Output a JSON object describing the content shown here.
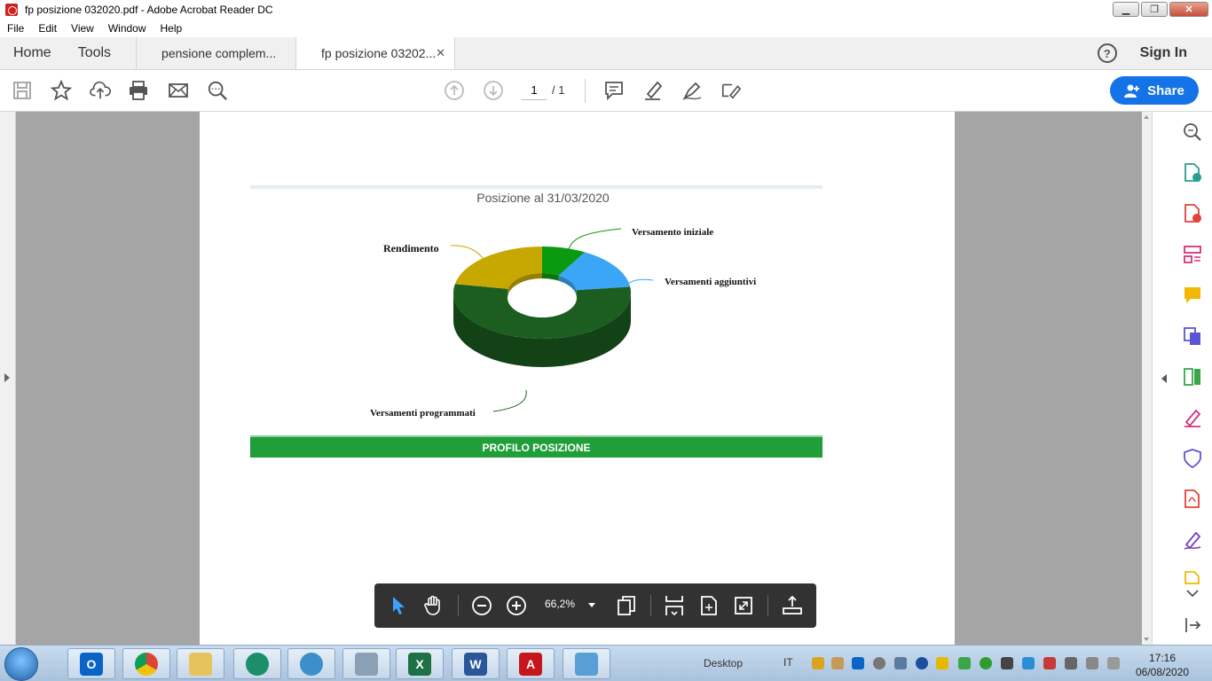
{
  "window": {
    "title": "fp posizione 032020.pdf - Adobe Acrobat Reader DC",
    "buttons": {
      "minimize": "▁",
      "maximize": "❐",
      "close": "✕"
    }
  },
  "menu": [
    "File",
    "Edit",
    "View",
    "Window",
    "Help"
  ],
  "tabs": {
    "home": "Home",
    "tools": "Tools",
    "documents": [
      {
        "label": "pensione complem...",
        "active": false
      },
      {
        "label": "fp posizione 03202...",
        "active": true,
        "close": "✕"
      }
    ],
    "help": "?",
    "sign_in": "Sign In"
  },
  "toolbar": {
    "icons": [
      "save-icon",
      "bookmark-star-icon",
      "upload-cloud-icon",
      "print-icon",
      "email-icon",
      "find-icon",
      "prev-page-icon",
      "next-page-icon",
      "comment-icon",
      "highlight-icon",
      "sign-icon",
      "fill-sign-icon"
    ],
    "page_current": "1",
    "page_total": "/ 1",
    "share_label": "Share"
  },
  "document": {
    "chart_title": "Posizione al 31/03/2020",
    "footer_bar": "PROFILO POSIZIONE"
  },
  "chart_data": {
    "type": "pie",
    "style": "3d-donut",
    "title": "Posizione al 31/03/2020",
    "slices": [
      {
        "label": "Versamento iniziale",
        "value": 8,
        "color": "#0a9a10"
      },
      {
        "label": "Versamenti aggiuntivi",
        "value": 15,
        "color": "#3aa6f5"
      },
      {
        "label": "Versamenti programmati",
        "value": 55,
        "color": "#1b5e20"
      },
      {
        "label": "Rendimento",
        "value": 22,
        "color": "#c6a800"
      }
    ]
  },
  "floating_toolbar": {
    "zoom": "66,2%",
    "icons": [
      "select-pointer-icon",
      "hand-icon",
      "zoom-out-icon",
      "zoom-in-icon",
      "page-view-icon",
      "scroll-mode-icon",
      "fit-page-icon",
      "fullscreen-icon",
      "read-mode-icon"
    ]
  },
  "right_panel": {
    "icons": [
      "enhance-scan-icon",
      "export-pdf-icon",
      "create-pdf-icon",
      "organize-pages-icon",
      "comment-icon",
      "combine-files-icon",
      "compress-icon",
      "fill-sign-icon",
      "protect-icon",
      "pdf-icon",
      "sign-pen-icon",
      "more-tools-icon",
      "expand-icon"
    ]
  },
  "taskbar": {
    "apps": [
      "outlook",
      "chrome",
      "explorer",
      "app-green",
      "app-globe",
      "calculator",
      "excel",
      "word",
      "acrobat",
      "photos"
    ],
    "desktop_label": "Desktop",
    "language": "IT",
    "time": "17:16",
    "date": "06/08/2020"
  },
  "colors": {
    "accent": "#1473e6",
    "green_bar": "#1f9e3a",
    "doc_background": "#a5a5a5"
  }
}
